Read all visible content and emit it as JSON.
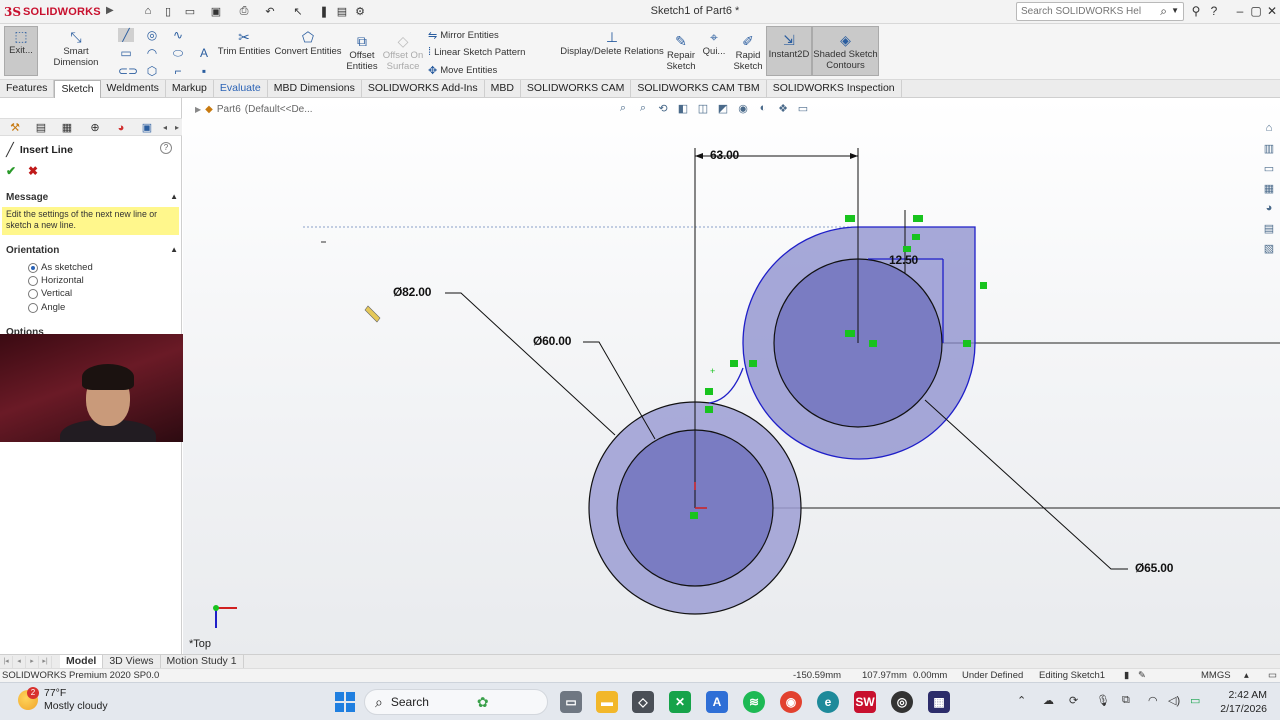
{
  "app": {
    "logo_ds": "3S",
    "logo_name": "SOLIDWORKS",
    "doc_title": "Sketch1 of Part6 *",
    "search_placeholder": "Search SOLIDWORKS Help",
    "help_label": "?"
  },
  "commands": {
    "exit_sketch": "Exit...",
    "smart_dimension": "Smart Dimension",
    "trim_entities": "Trim Entities",
    "convert_entities": "Convert Entities",
    "offset_entities_1": "Offset",
    "offset_entities_2": "Entities",
    "offset_surface_1": "Offset On",
    "offset_surface_2": "Surface",
    "mirror_entities": "Mirror Entities",
    "linear_pattern": "Linear Sketch Pattern",
    "move_entities": "Move Entities",
    "display_delete_relations": "Display/Delete Relations",
    "repair_sketch_1": "Repair",
    "repair_sketch_2": "Sketch",
    "quick_snaps": "Qui...",
    "rapid_sketch_1": "Rapid",
    "rapid_sketch_2": "Sketch",
    "instant2d": "Instant2D",
    "shaded_contours_1": "Shaded Sketch",
    "shaded_contours_2": "Contours"
  },
  "tabs": [
    {
      "label": "Features",
      "active": false
    },
    {
      "label": "Sketch",
      "active": true
    },
    {
      "label": "Weldments",
      "active": false
    },
    {
      "label": "Markup",
      "active": false
    },
    {
      "label": "Evaluate",
      "active": false
    },
    {
      "label": "MBD Dimensions",
      "active": false
    },
    {
      "label": "SOLIDWORKS Add-Ins",
      "active": false
    },
    {
      "label": "MBD",
      "active": false
    },
    {
      "label": "SOLIDWORKS CAM",
      "active": false
    },
    {
      "label": "SOLIDWORKS CAM TBM",
      "active": false
    },
    {
      "label": "SOLIDWORKS Inspection",
      "active": false
    }
  ],
  "property_manager": {
    "title": "Insert Line",
    "help": "?",
    "ok": "✔",
    "cancel": "✖",
    "message_header": "Message",
    "message_text": "Edit the settings of the next new line or sketch a new line.",
    "orientation_header": "Orientation",
    "orientation_options": [
      "As sketched",
      "Horizontal",
      "Vertical",
      "Angle"
    ],
    "orientation_selected": "As sketched",
    "options_header": "Options"
  },
  "graphics": {
    "breadcrumb_part": "Part6",
    "breadcrumb_config": "(Default<<De...",
    "view_label": "*Top",
    "dimensions": {
      "width_63": "63.00",
      "offset_1250": "12.50",
      "dia_82": "Ø82.00",
      "dia_60": "Ø60.00",
      "dia_65": "Ø65.00"
    }
  },
  "bottom_tabs": [
    {
      "label": "Model",
      "active": true
    },
    {
      "label": "3D Views",
      "active": false
    },
    {
      "label": "Motion Study 1",
      "active": false
    }
  ],
  "status": {
    "product": "SOLIDWORKS Premium 2020 SP0.0",
    "x_coord": "-150.59mm",
    "y_coord": "107.97mm",
    "z_coord": "0.00mm",
    "sketch_state": "Under Defined",
    "editing": "Editing Sketch1",
    "units": "MMGS"
  },
  "taskbar": {
    "weather_temp": "77°F",
    "weather_desc": "Mostly cloudy",
    "weather_badge": "2",
    "search_label": "Search",
    "time": "2:42 AM",
    "date": "2/17/2026"
  },
  "colors": {
    "solidworks_red": "#c8102e",
    "sketch_blue": "#1f1fc8",
    "region_fill": "#8a8ccc",
    "message_yellow": "#fff78c",
    "relation_green": "#18c31e"
  }
}
